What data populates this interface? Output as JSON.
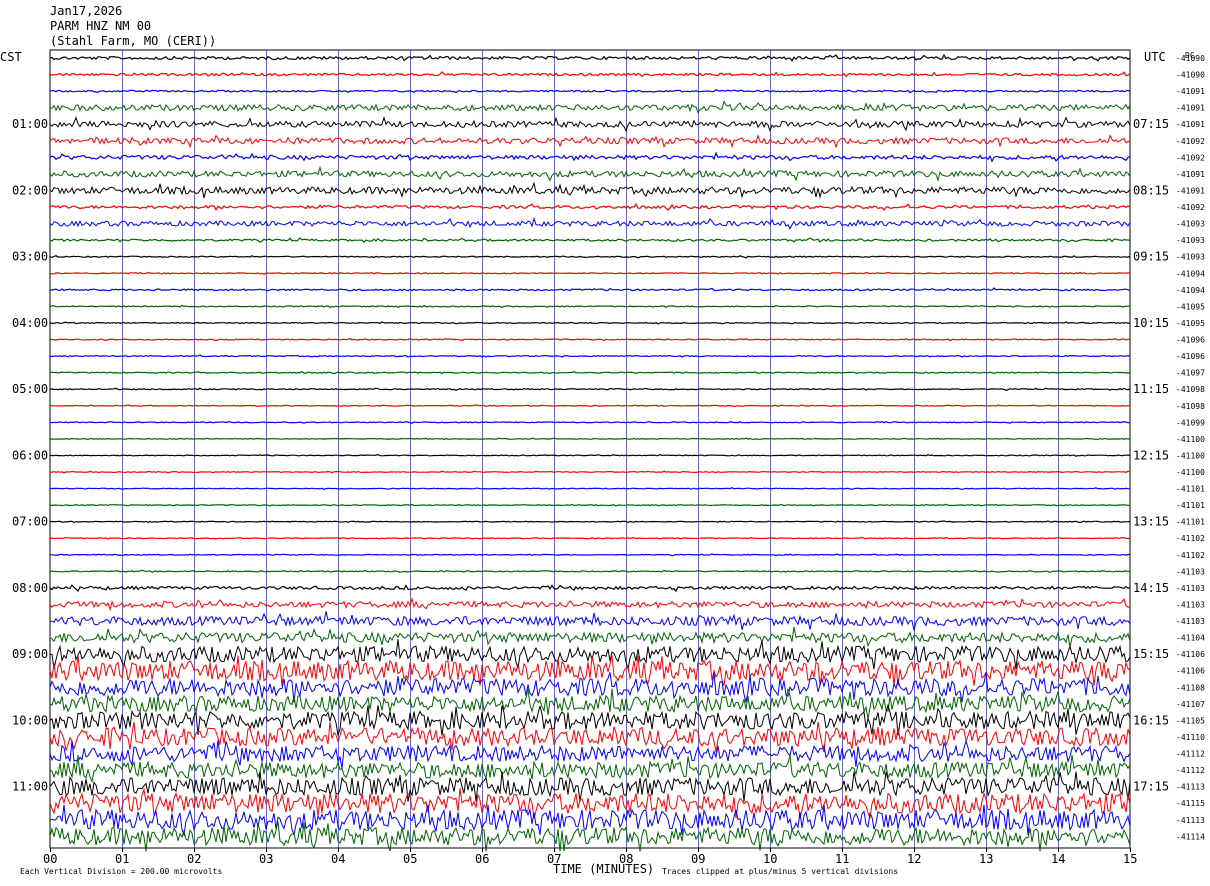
{
  "header": {
    "date": "Jan17,2026",
    "station": "PARM HNZ NM 00",
    "location": "(Stahl Farm, MO (CERI))"
  },
  "left_tz": "CST",
  "right_tz": "UTC",
  "dc_label": "DC",
  "footer": {
    "scale": "Each Vertical Division =  200.00 microvolts",
    "xlabel": "TIME (MINUTES)",
    "clip": "Traces clipped at plus/minus 5 vertical divisions"
  },
  "chart_data": {
    "type": "line",
    "title": "PARM HNZ NM 00",
    "xlabel": "TIME (MINUTES)",
    "xlim": [
      0,
      15
    ],
    "x_ticks": [
      "00",
      "01",
      "02",
      "03",
      "04",
      "05",
      "06",
      "07",
      "08",
      "09",
      "10",
      "11",
      "12",
      "13",
      "14",
      "15"
    ],
    "left_hour_labels": [
      "01:00",
      "02:00",
      "03:00",
      "04:00",
      "05:00",
      "06:00",
      "07:00",
      "08:00",
      "09:00",
      "10:00",
      "11:00"
    ],
    "right_hour_labels": [
      "07:15",
      "08:15",
      "09:15",
      "10:15",
      "11:15",
      "12:15",
      "13:15",
      "14:15",
      "15:15",
      "16:15",
      "17:15"
    ],
    "trace_colors": [
      "#000000",
      "#ff0000",
      "#0000ff",
      "#006400"
    ],
    "grid_color": "#0000cc",
    "dc_offsets": [
      "-41090",
      "-41090",
      "-41091",
      "-41091",
      "-41091",
      "-41092",
      "-41092",
      "-41091",
      "-41091",
      "-41092",
      "-41093",
      "-41093",
      "-41093",
      "-41094",
      "-41094",
      "-41095",
      "-41095",
      "-41096",
      "-41096",
      "-41097",
      "-41098",
      "-41098",
      "-41099",
      "-41100",
      "-41100",
      "-41100",
      "-41101",
      "-41101",
      "-41101",
      "-41102",
      "-41102",
      "-41103",
      "-41103",
      "-41103",
      "-41103",
      "-41104",
      "-41106",
      "-41106",
      "-41108",
      "-41107",
      "-41105",
      "-41110",
      "-41112",
      "-41112",
      "-41113",
      "-41115",
      "-41113",
      "-41114"
    ],
    "trace_amplitude": [
      1.5,
      1.2,
      0.8,
      3.0,
      3.0,
      3.0,
      2.0,
      3.0,
      3.5,
      1.5,
      2.5,
      1.0,
      0.5,
      0.5,
      0.8,
      0.5,
      0.5,
      0.5,
      0.5,
      0.5,
      0.5,
      0.4,
      0.4,
      0.4,
      0.4,
      0.4,
      0.4,
      0.4,
      0.4,
      0.4,
      0.4,
      0.5,
      1.5,
      3.0,
      4.5,
      5.0,
      8.0,
      10.0,
      9.0,
      8.0,
      9.0,
      9.0,
      8.0,
      8.0,
      9.0,
      10.0,
      10.0,
      9.0
    ]
  }
}
